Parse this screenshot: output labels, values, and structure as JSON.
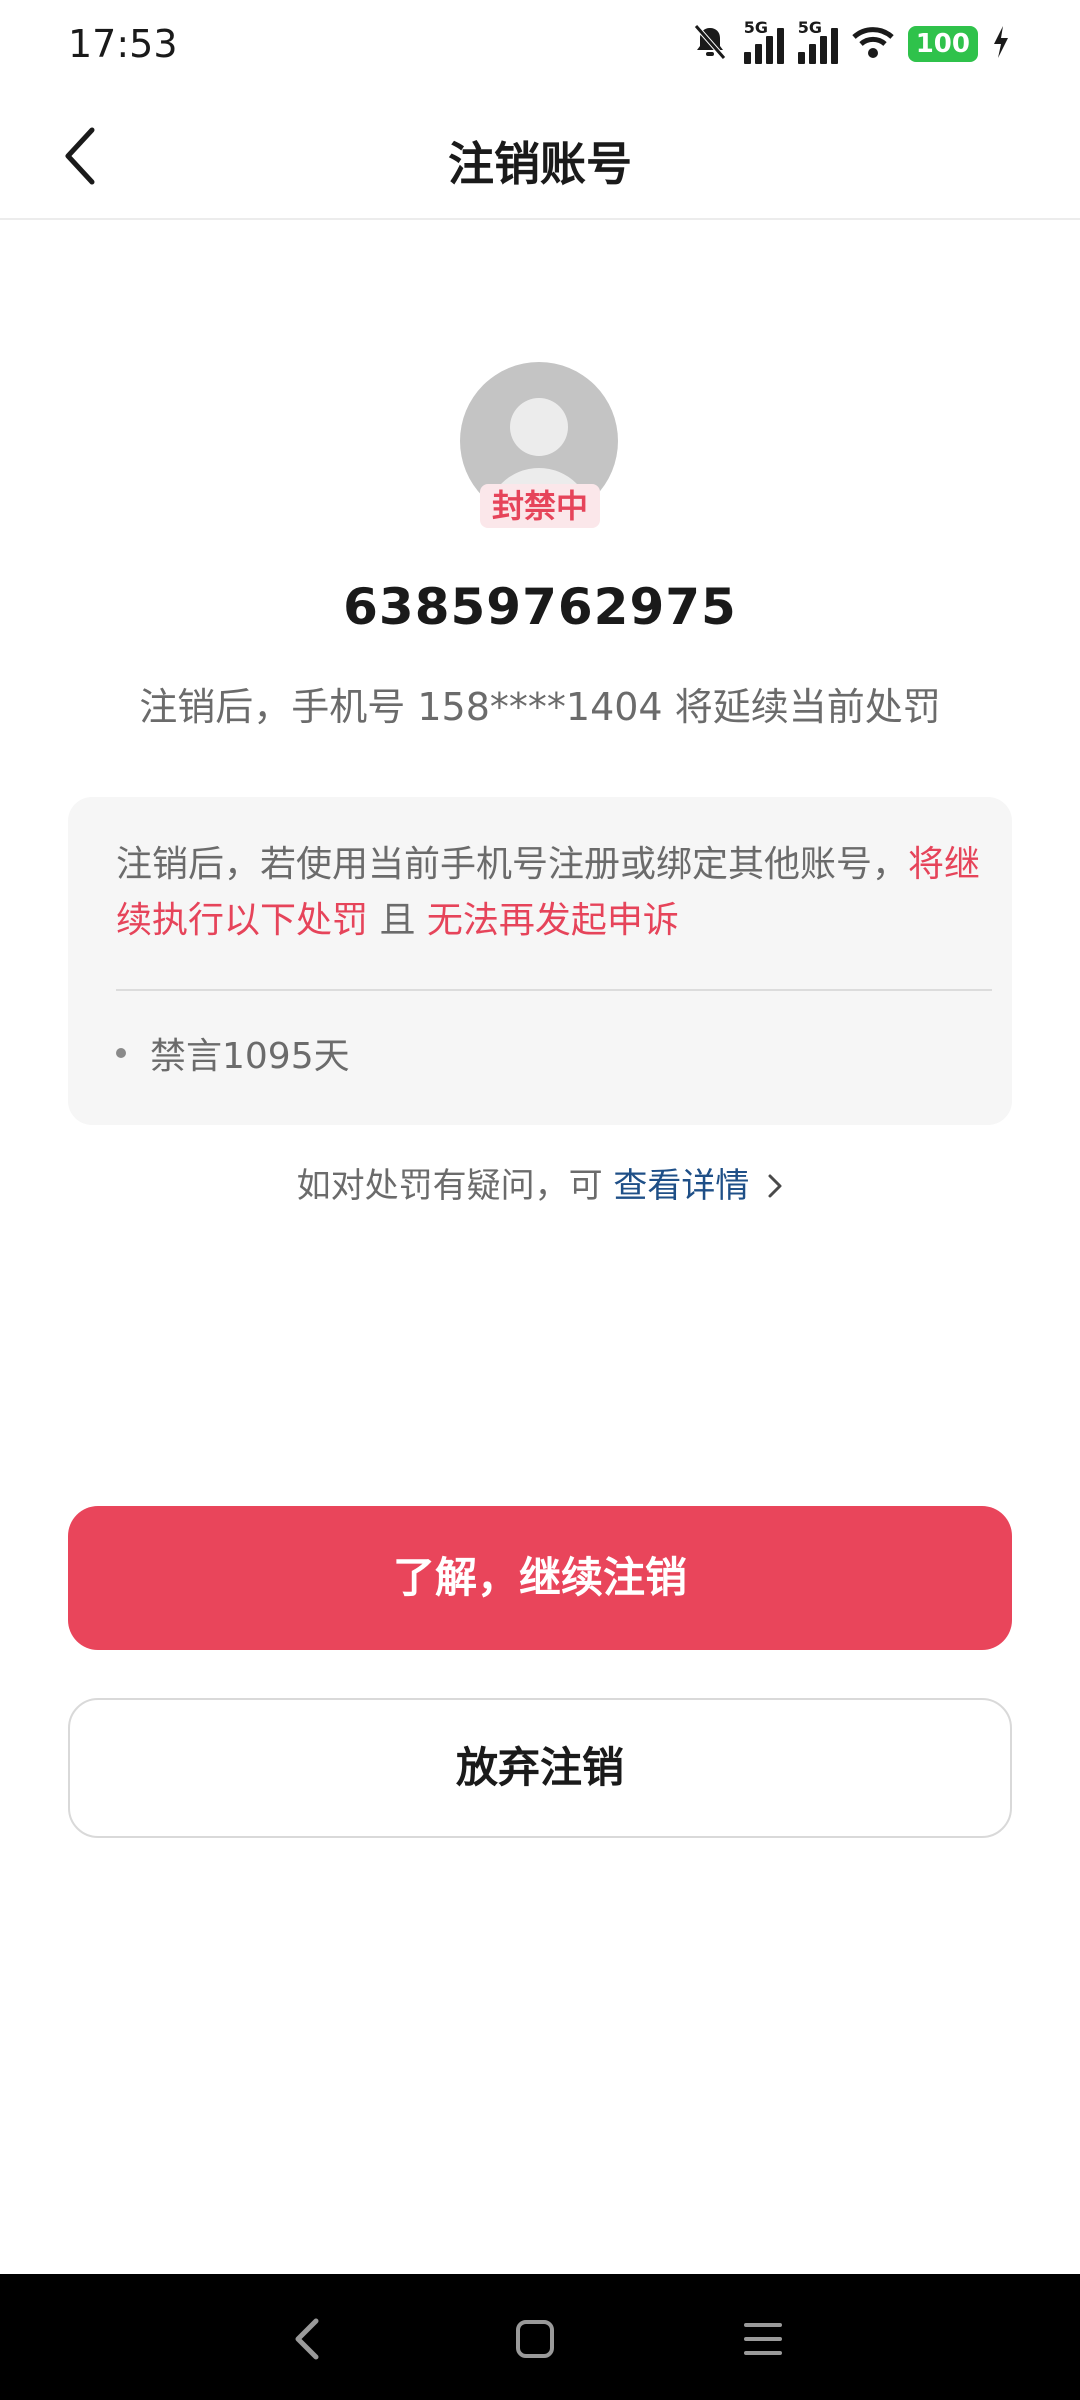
{
  "status_bar": {
    "time": "17:53",
    "sim1_tag": "5G",
    "sim2_tag": "5G",
    "battery": "100"
  },
  "header": {
    "title": "注销账号"
  },
  "profile": {
    "badge": "封禁中",
    "user_id": "63859762975",
    "note": "注销后，手机号 158****1404 将延续当前处罚"
  },
  "card": {
    "text_part1": "注销后，若使用当前手机号注册或绑定其他账号，",
    "text_red1": "将继续执行以下处罚",
    "text_part2": " 且 ",
    "text_red2": "无法再发起申诉",
    "penalty_item": "禁言1095天"
  },
  "appeal": {
    "prefix": "如对处罚有疑问，可 ",
    "link_text": "查看详情"
  },
  "buttons": {
    "continue_label": "了解，继续注销",
    "abandon_label": "放弃注销"
  },
  "colors": {
    "accent_red": "#e9455b",
    "link_blue": "#1e4f87",
    "battery_green": "#2fc24b"
  }
}
